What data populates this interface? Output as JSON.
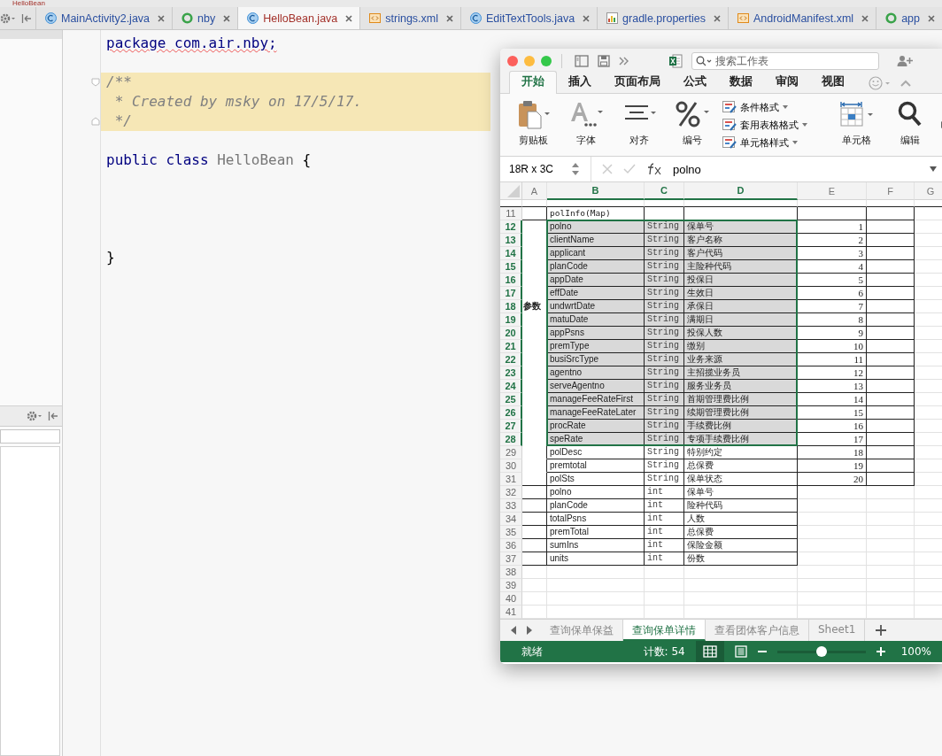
{
  "ide": {
    "breadcrumb": "HelloBean",
    "tabs": [
      {
        "label": "MainActivity2.java",
        "kind": "class",
        "selected": false
      },
      {
        "label": "nby",
        "kind": "module",
        "selected": false
      },
      {
        "label": "HelloBean.java",
        "kind": "class",
        "selected": true
      },
      {
        "label": "strings.xml",
        "kind": "xml",
        "selected": false
      },
      {
        "label": "EditTextTools.java",
        "kind": "class",
        "selected": false
      },
      {
        "label": "gradle.properties",
        "kind": "gradle",
        "selected": false
      },
      {
        "label": "AndroidManifest.xml",
        "kind": "xml",
        "selected": false
      },
      {
        "label": "app",
        "kind": "module",
        "selected": false
      }
    ],
    "code": [
      {
        "kind": "package",
        "text": "package com.air.nby;"
      },
      {
        "kind": "blank"
      },
      {
        "kind": "comment",
        "text": "/**"
      },
      {
        "kind": "comment",
        "text": " * Created by msky on 17/5/17."
      },
      {
        "kind": "comment",
        "text": " */"
      },
      {
        "kind": "blank"
      },
      {
        "kind": "class",
        "keyword": "public class",
        "name": "HelloBean",
        "text": "{"
      },
      {
        "kind": "blank"
      },
      {
        "kind": "blank"
      },
      {
        "kind": "blank"
      },
      {
        "kind": "blank"
      },
      {
        "kind": "plain",
        "text": "}"
      }
    ]
  },
  "excel": {
    "search": {
      "placeholder": "搜索工作表"
    },
    "ribbon_tabs": [
      {
        "label": "开始",
        "selected": true
      },
      {
        "label": "插入",
        "selected": false
      },
      {
        "label": "页面布局",
        "selected": false
      },
      {
        "label": "公式",
        "selected": false
      },
      {
        "label": "数据",
        "selected": false
      },
      {
        "label": "审阅",
        "selected": false
      },
      {
        "label": "视图",
        "selected": false
      }
    ],
    "ribbon_groups": [
      {
        "kind": "clipboard",
        "label": "剪贴板"
      },
      {
        "kind": "font",
        "label": "字体"
      },
      {
        "kind": "align",
        "label": "对齐"
      },
      {
        "kind": "number",
        "label": "编号"
      },
      {
        "kind": "styles",
        "items": [
          "条件格式",
          "套用表格格式",
          "单元格样式"
        ]
      },
      {
        "kind": "cells",
        "label": "单元格"
      },
      {
        "kind": "edit",
        "label": "编辑"
      }
    ],
    "name_box": "18R x 3C",
    "formula": "polno",
    "columns": [
      {
        "label": "A",
        "selected": false
      },
      {
        "label": "B",
        "selected": true
      },
      {
        "label": "C",
        "selected": true
      },
      {
        "label": "D",
        "selected": true
      },
      {
        "label": "E",
        "selected": false
      },
      {
        "label": "F",
        "selected": false
      },
      {
        "label": "G",
        "selected": false
      }
    ],
    "rows": [
      {
        "number": "11",
        "kind": "title",
        "name": "polInfo(Map)",
        "selected": false
      },
      {
        "number": "12",
        "kind": "field",
        "name": "polno",
        "type": "String",
        "description": "保单号",
        "index": "1",
        "selected": true
      },
      {
        "number": "13",
        "kind": "field",
        "name": "clientName",
        "type": "String",
        "description": "客户名称",
        "index": "2",
        "selected": true
      },
      {
        "number": "14",
        "kind": "field",
        "name": "applicant",
        "type": "String",
        "description": "客户代码",
        "index": "3",
        "selected": true
      },
      {
        "number": "15",
        "kind": "field",
        "name": "planCode",
        "type": "String",
        "description": "主险种代码",
        "index": "4",
        "selected": true
      },
      {
        "number": "16",
        "kind": "field",
        "name": "appDate",
        "type": "String",
        "description": "投保日",
        "index": "5",
        "selected": true
      },
      {
        "number": "17",
        "kind": "field",
        "name": "effDate",
        "type": "String",
        "description": "生效日",
        "index": "6",
        "selected": true
      },
      {
        "number": "18",
        "kind": "field",
        "label": "参数",
        "name": "undwrtDate",
        "type": "String",
        "description": "承保日",
        "index": "7",
        "selected": true
      },
      {
        "number": "19",
        "kind": "field",
        "name": "matuDate",
        "type": "String",
        "description": "满期日",
        "index": "8",
        "selected": true
      },
      {
        "number": "20",
        "kind": "field",
        "name": "appPsns",
        "type": "String",
        "description": "投保人数",
        "index": "9",
        "selected": true
      },
      {
        "number": "21",
        "kind": "field",
        "name": "premType",
        "type": "String",
        "description": "缴别",
        "index": "10",
        "selected": true
      },
      {
        "number": "22",
        "kind": "field",
        "name": "busiSrcType",
        "type": "String",
        "description": "业务来源",
        "index": "11",
        "selected": true
      },
      {
        "number": "23",
        "kind": "field",
        "name": "agentno",
        "type": "String",
        "description": "主招揽业务员",
        "index": "12",
        "selected": true
      },
      {
        "number": "24",
        "kind": "field",
        "name": "serveAgentno",
        "type": "String",
        "description": "服务业务员",
        "index": "13",
        "selected": true
      },
      {
        "number": "25",
        "kind": "field",
        "name": "manageFeeRateFirst",
        "type": "String",
        "description": "首期管理费比例",
        "index": "14",
        "selected": true
      },
      {
        "number": "26",
        "kind": "field",
        "name": "manageFeeRateLater",
        "type": "String",
        "description": "续期管理费比例",
        "index": "15",
        "selected": true
      },
      {
        "number": "27",
        "kind": "field",
        "name": "procRate",
        "type": "String",
        "description": "手续费比例",
        "index": "16",
        "selected": true
      },
      {
        "number": "28",
        "kind": "field",
        "name": "speRate",
        "type": "String",
        "description": "专项手续费比例",
        "index": "17",
        "selected": true
      },
      {
        "number": "29",
        "kind": "field",
        "name": "polDesc",
        "type": "String",
        "description": "特别约定",
        "index": "18",
        "selected": false
      },
      {
        "number": "30",
        "kind": "field",
        "name": "premtotal",
        "type": "String",
        "description": "总保费",
        "index": "19",
        "selected": false
      },
      {
        "number": "31",
        "kind": "field",
        "name": "polSts",
        "type": "String",
        "description": "保单状态",
        "index": "20",
        "selected": false
      },
      {
        "number": "32",
        "kind": "field",
        "name": "polno",
        "type": "int",
        "description": "保单号",
        "selected": false
      },
      {
        "number": "33",
        "kind": "field",
        "name": "planCode",
        "type": "int",
        "description": "险种代码",
        "selected": false
      },
      {
        "number": "34",
        "kind": "field",
        "name": "totalPsns",
        "type": "int",
        "description": "人数",
        "selected": false
      },
      {
        "number": "35",
        "kind": "field",
        "name": "premTotal",
        "type": "int",
        "description": "总保费",
        "selected": false
      },
      {
        "number": "36",
        "kind": "field",
        "name": "sumIns",
        "type": "int",
        "description": "保险金额",
        "selected": false
      },
      {
        "number": "37",
        "kind": "field",
        "name": "units",
        "type": "int",
        "description": "份数",
        "selected": false
      },
      {
        "number": "38",
        "kind": "empty",
        "selected": false
      },
      {
        "number": "39",
        "kind": "empty",
        "selected": false
      },
      {
        "number": "40",
        "kind": "empty",
        "selected": false
      },
      {
        "number": "41",
        "kind": "empty",
        "selected": false
      }
    ],
    "sheets": [
      {
        "label": "查询保单保益",
        "selected": false
      },
      {
        "label": "查询保单详情",
        "selected": true
      },
      {
        "label": "查看团体客户信息",
        "selected": false
      },
      {
        "label": "Sheet1",
        "selected": false
      }
    ],
    "status": {
      "text": "就绪",
      "count": "计数: 54",
      "zoom": {
        "level": 0.5
      },
      "zoom_text": "100%"
    }
  }
}
